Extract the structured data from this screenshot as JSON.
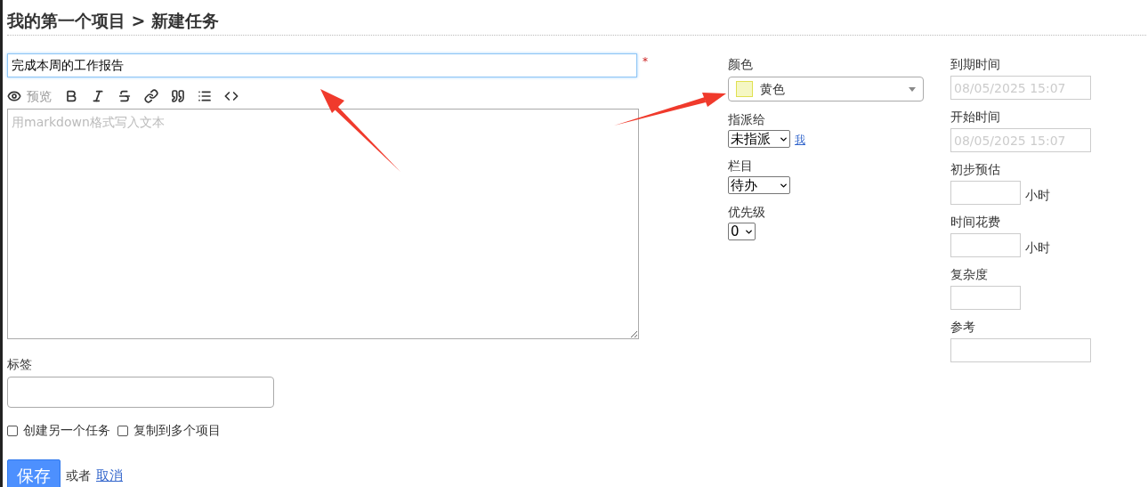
{
  "page_title": "我的第一个项目 > 新建任务",
  "title_field": {
    "value": "完成本周的工作报告",
    "required_mark": "*"
  },
  "editor": {
    "preview_label": "预览",
    "placeholder": "用markdown格式写入文本"
  },
  "tags": {
    "label": "标签"
  },
  "options": [
    {
      "label": "创建另一个任务",
      "checked": false
    },
    {
      "label": "复制到多个项目",
      "checked": false
    }
  ],
  "actions": {
    "save": "保存",
    "or": "或者",
    "cancel": "取消"
  },
  "middle_fields": [
    {
      "kind": "color",
      "label": "颜色",
      "value": "黄色",
      "color": "#f5f7c4"
    },
    {
      "kind": "select",
      "label": "指派给",
      "value": "未指派",
      "link": "我"
    },
    {
      "kind": "select",
      "label": "栏目",
      "value": "待办"
    },
    {
      "kind": "select",
      "label": "优先级",
      "value": "0"
    }
  ],
  "right_fields": [
    {
      "kind": "date",
      "label": "到期时间",
      "placeholder": "08/05/2025 15:07"
    },
    {
      "kind": "date",
      "label": "开始时间",
      "placeholder": "08/05/2025 15:07"
    },
    {
      "kind": "hours",
      "label": "初步预估",
      "unit": "小时"
    },
    {
      "kind": "hours",
      "label": "时间花费",
      "unit": "小时"
    },
    {
      "kind": "short",
      "label": "复杂度"
    },
    {
      "kind": "wide",
      "label": "参考"
    }
  ]
}
